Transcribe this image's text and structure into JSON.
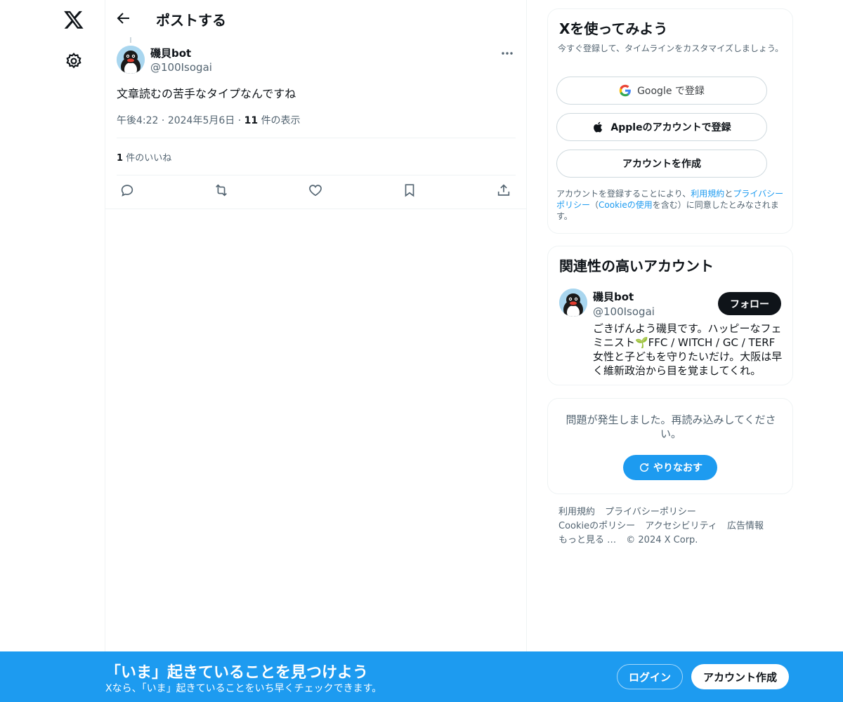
{
  "colors": {
    "accent": "#1d9bf0",
    "text_primary": "#0f1419",
    "text_secondary": "#536471",
    "border": "#eff3f4"
  },
  "nav": {
    "logo_icon": "x-logo-icon",
    "settings_icon": "gear-icon"
  },
  "header": {
    "back_icon": "arrow-left-icon",
    "title": "ポストする"
  },
  "post": {
    "author_name": "磯貝bot",
    "author_handle": "@100Isogai",
    "text": "文章読むの苦手なタイプなんですね",
    "time": "午後4:22",
    "separator": "·",
    "date": "2024年5月6日",
    "views_count": "11",
    "views_label": "件の表示",
    "likes_count": "1",
    "likes_label": "件のいいね",
    "actions": [
      "reply-icon",
      "retweet-icon",
      "like-icon",
      "bookmark-icon",
      "share-icon"
    ]
  },
  "signup_card": {
    "title": "Xを使ってみよう",
    "subtitle": "今すぐ登録して、タイムラインをカスタマイズしましょう。",
    "google_label": "Google で登録",
    "apple_label": "Appleのアカウントで登録",
    "create_label": "アカウントを作成",
    "terms_prefix": "アカウントを登録することにより、",
    "terms_link": "利用規約",
    "terms_and": "と",
    "privacy_link": "プライバシーポリシー",
    "cookie_open": "（",
    "cookie_link": "Cookieの使用",
    "terms_suffix": "を含む）に同意したとみなされます。"
  },
  "related": {
    "title": "関連性の高いアカウント",
    "name": "磯貝bot",
    "handle": "@100Isogai",
    "follow_label": "フォロー",
    "bio": "ごきげんよう磯貝です。ハッピーなフェミニスト🌱FFC / WITCH / GC / TERF 女性と子どもを守りたいだけ。大阪は早く維新政治から目を覚ましてくれ。"
  },
  "error_card": {
    "message": "問題が発生しました。再読み込みしてください。",
    "retry_label": "やりなおす"
  },
  "footer": {
    "links": [
      "利用規約",
      "プライバシーポリシー",
      "Cookieのポリシー",
      "アクセシビリティ",
      "広告情報",
      "もっと見る …",
      "© 2024 X Corp."
    ]
  },
  "banner": {
    "title": "「いま」起きていることを見つけよう",
    "subtitle": "Xなら、「いま」起きていることをいち早くチェックできます。",
    "login_label": "ログイン",
    "signup_label": "アカウント作成"
  }
}
